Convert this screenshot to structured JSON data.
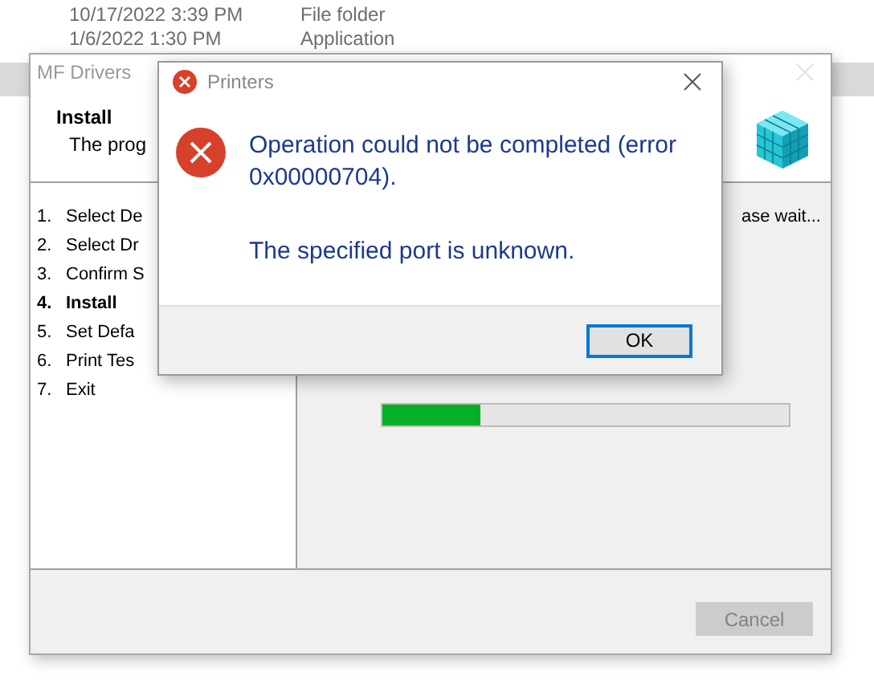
{
  "explorer": {
    "rows": [
      {
        "date": "10/17/2022 3:39 PM",
        "type": "File folder"
      },
      {
        "date": "1/6/2022 1:30 PM",
        "type": "Application"
      }
    ]
  },
  "installer": {
    "title": "MF Drivers",
    "heading": "Install",
    "description": "The prog",
    "steps": [
      {
        "number": "1.",
        "label": "Select De",
        "selected": false
      },
      {
        "number": "2.",
        "label": "Select Dr",
        "selected": false
      },
      {
        "number": "3.",
        "label": "Confirm S",
        "selected": false
      },
      {
        "number": "4.",
        "label": "Install",
        "selected": true
      },
      {
        "number": "5.",
        "label": "Set Defa",
        "selected": false
      },
      {
        "number": "6.",
        "label": "Print Tes",
        "selected": false
      },
      {
        "number": "7.",
        "label": "Exit",
        "selected": false
      }
    ],
    "status": "ase wait...",
    "progress": {
      "level": 0.24
    },
    "cancel": {
      "label": "Cancel",
      "disabled": true
    }
  },
  "dialog": {
    "title": "Printers",
    "message": "Operation could not be completed (error 0x00000704).",
    "detail": "The specified port is unknown.",
    "button": "OK"
  }
}
